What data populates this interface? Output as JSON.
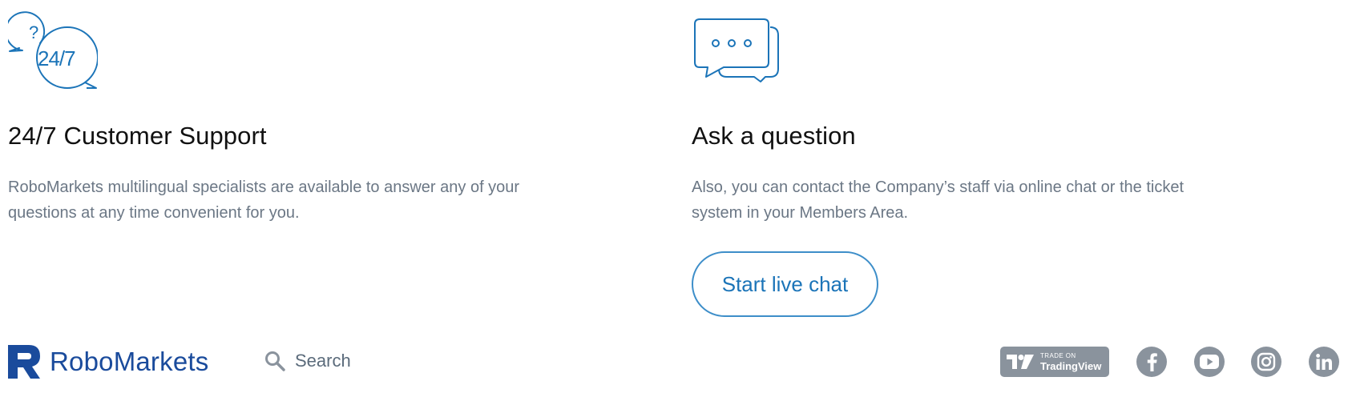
{
  "support": {
    "title": "24/7 Customer Support",
    "text": "RoboMarkets multilingual specialists are available to answer any of your questions at any time convenient for you.",
    "icon": "24-7-chat-bubbles-icon",
    "icon_question_mark": "?",
    "icon_label": "24/7"
  },
  "ask": {
    "title": "Ask a question",
    "text": "Also, you can contact the Company’s staff via online chat or the ticket system in your Members Area.",
    "icon": "chat-bubbles-ellipsis-icon",
    "button_label": "Start live chat"
  },
  "footer": {
    "logo_text": "RoboMarkets",
    "search_placeholder": "Search",
    "tradingview": {
      "small_text": "TRADE ON",
      "big_text": "TradingView"
    },
    "social": [
      "facebook-icon",
      "youtube-icon",
      "instagram-icon",
      "linkedin-icon"
    ]
  },
  "colors": {
    "accent": "#1b74b8",
    "brand": "#1a4b9c",
    "text_muted": "#6b7785",
    "icon_grey": "#8a939d",
    "button_border": "#3d8ec9"
  }
}
